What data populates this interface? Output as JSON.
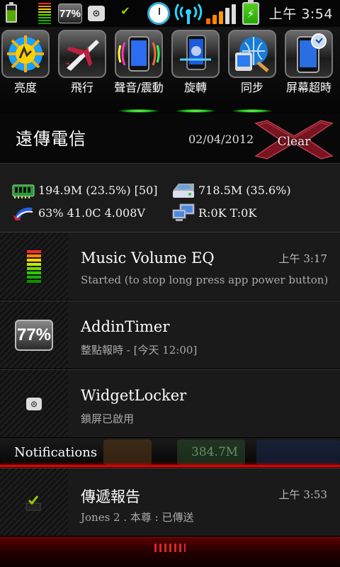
{
  "status_bar": {
    "battery_pct_badge": "77%",
    "time": "上午 3:54",
    "eq_colors": [
      "#ff2a2a",
      "#ff8a00",
      "#ffd400",
      "#c8e600",
      "#6fdc00",
      "#2fc800",
      "#19b000",
      "#109000"
    ]
  },
  "toggles": [
    {
      "label": "亮度",
      "icon": "brightness-icon",
      "active": false
    },
    {
      "label": "飛行",
      "icon": "airplane-icon",
      "active": false
    },
    {
      "label": "聲音/震動",
      "icon": "sound-vibrate-icon",
      "active": true
    },
    {
      "label": "旋轉",
      "icon": "rotate-icon",
      "active": true
    },
    {
      "label": "同步",
      "icon": "sync-icon",
      "active": true
    },
    {
      "label": "屏幕超時",
      "icon": "screen-timeout-icon",
      "active": false
    }
  ],
  "carrier": {
    "name": "遠傳電信",
    "date": "02/04/2012",
    "clear_label": "Clear"
  },
  "stats": {
    "ram": "194.9M (23.5%) [50]",
    "storage": "718.5M (35.6%)",
    "battery": "63% 41.0C 4.008V",
    "network": "R:0K T:0K"
  },
  "notifications_ongoing": [
    {
      "title": "Music Volume EQ",
      "subtitle": "Started (to stop long press app power button)",
      "time": "上午 3:17",
      "icon": "equalizer-icon"
    },
    {
      "title": "AddinTimer",
      "subtitle": "整點報時 - [今天 12:00]",
      "time": "",
      "icon": "battery-percent-icon",
      "icon_text": "77%"
    },
    {
      "title": "WidgetLocker",
      "subtitle": "鎖屏已啟用",
      "time": "",
      "icon": "lock-icon"
    }
  ],
  "notifications_header": {
    "label": "Notifications",
    "ghost_text": "384.7M"
  },
  "notifications": [
    {
      "title": "傳遞報告",
      "subtitle": "Jones 2 . 本尊 : 已傳送",
      "time": "上午 3:53",
      "icon": "delivered-check-icon"
    }
  ]
}
